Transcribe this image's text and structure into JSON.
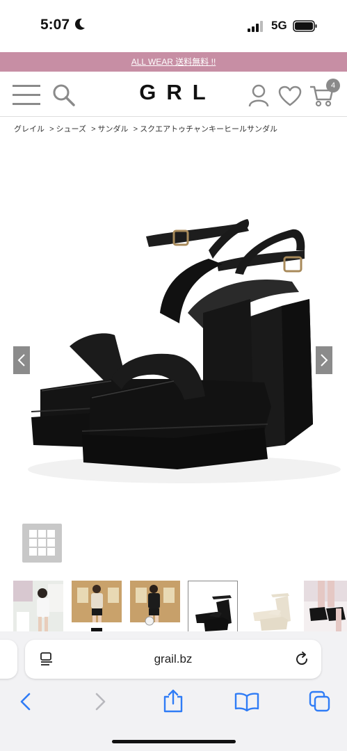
{
  "status_bar": {
    "time": "5:07",
    "network": "5G"
  },
  "promo": {
    "text": "ALL WEAR 送料無料 !!"
  },
  "header": {
    "logo": "GRL",
    "cart_count": "4"
  },
  "breadcrumb": [
    "グレイル",
    "> シューズ",
    "> サンダル",
    "> スクエアトゥチャンキーヒールサンダル"
  ],
  "gallery": {
    "thumbnail_count": 6,
    "selected_index": 3
  },
  "browser": {
    "url": "grail.bz"
  },
  "colors": {
    "promo_bg": "#c78ea4",
    "header_icon": "#8a8a8a"
  }
}
